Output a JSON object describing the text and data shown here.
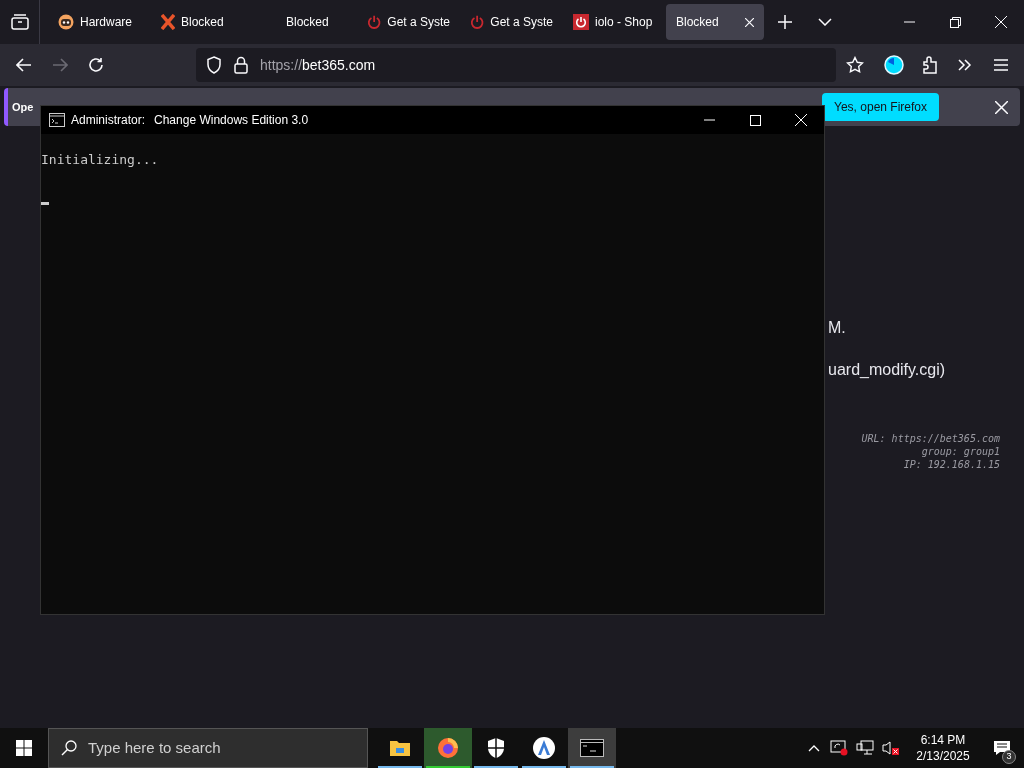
{
  "browser": {
    "tabs": [
      {
        "kind": "face",
        "label": "Hardware",
        "selected": false
      },
      {
        "kind": "x",
        "label": "Blocked",
        "selected": false
      },
      {
        "kind": "plain",
        "label": "Blocked",
        "selected": false
      },
      {
        "kind": "power",
        "label": "Get a Syste",
        "selected": false
      },
      {
        "kind": "power",
        "label": "Get a Syste",
        "selected": false
      },
      {
        "kind": "powerbox",
        "label": "iolo - Shop",
        "selected": false
      },
      {
        "kind": "plain",
        "label": "Blocked",
        "selected": true
      }
    ],
    "url_scheme": "https://",
    "url_host": "bet365.com",
    "notification": {
      "text": "Ope",
      "button": "Yes, open Firefox"
    },
    "page": {
      "fragments": [
        "M.",
        "uard_modify.cgi)"
      ],
      "info": [
        "URL: https://bet365.com",
        "group: group1",
        "IP: 192.168.1.15"
      ]
    }
  },
  "console": {
    "title_prefix": "Administrator:",
    "title": "Change Windows Edition 3.0",
    "lines": [
      "Initializing..."
    ]
  },
  "taskbar": {
    "search_placeholder": "Type here to search",
    "apps": [
      {
        "kind": "folder",
        "running": true,
        "selected": false,
        "flashing": false
      },
      {
        "kind": "firefox",
        "running": true,
        "selected": false,
        "flashing": true
      },
      {
        "kind": "shield",
        "running": true,
        "selected": false,
        "flashing": false
      },
      {
        "kind": "app",
        "running": true,
        "selected": false,
        "flashing": false
      },
      {
        "kind": "terminal",
        "running": true,
        "selected": true,
        "flashing": false
      }
    ],
    "time": "6:14 PM",
    "date": "2/13/2025",
    "notifications": "3"
  }
}
